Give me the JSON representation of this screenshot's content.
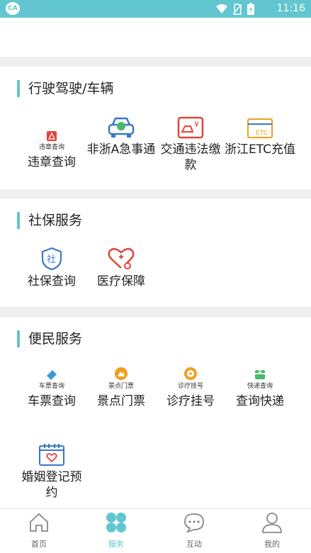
{
  "statusbar": {
    "app_badge": "CA",
    "time": "11:16"
  },
  "sections": {
    "driving": {
      "title": "行驶驾驶/车辆",
      "items": [
        {
          "tiny": "违章查询",
          "label": "违章查询",
          "icon": "warning-icon"
        },
        {
          "label": "非浙A急事通",
          "icon": "car-icon"
        },
        {
          "label": "交通违法缴款",
          "icon": "traffic-fine-icon"
        },
        {
          "label": "浙江ETC充值",
          "icon": "etc-card-icon",
          "icon_text": "ETC"
        }
      ]
    },
    "social": {
      "title": "社保服务",
      "items": [
        {
          "label": "社保查询",
          "icon": "shield-icon",
          "icon_text": "社"
        },
        {
          "label": "医疗保障",
          "icon": "medical-heart-icon"
        }
      ]
    },
    "convenience": {
      "title": "便民服务",
      "items": [
        {
          "tiny": "车票查询",
          "label": "车票查询",
          "icon": "ticket-icon"
        },
        {
          "tiny": "景点门票",
          "label": "景点门票",
          "icon": "scenic-icon"
        },
        {
          "tiny": "诊疗挂号",
          "label": "诊疗挂号",
          "icon": "clinic-icon"
        },
        {
          "tiny": "快递查询",
          "label": "查询快递",
          "icon": "parcel-icon"
        },
        {
          "label": "婚姻登记预约",
          "icon": "calendar-heart-icon"
        }
      ]
    }
  },
  "tabs": [
    {
      "label": "首页",
      "icon": "home-icon"
    },
    {
      "label": "服务",
      "icon": "services-icon",
      "active": true
    },
    {
      "label": "互动",
      "icon": "chat-icon"
    },
    {
      "label": "我的",
      "icon": "user-icon"
    }
  ],
  "colors": {
    "accent": "#62c6d0",
    "red": "#e0463c",
    "blue": "#3a78c8",
    "orange": "#f0a020"
  }
}
